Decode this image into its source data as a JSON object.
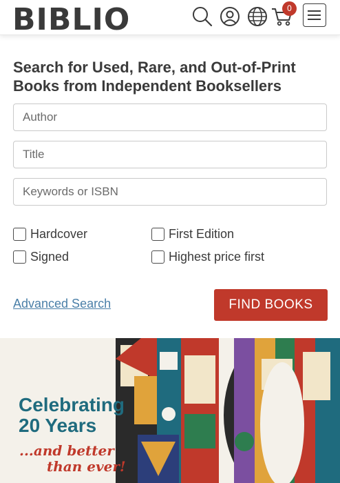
{
  "header": {
    "logo": "BIBLIO",
    "cart_count": "0",
    "icons": [
      "search-icon",
      "account-icon",
      "globe-icon",
      "cart-icon",
      "menu-icon"
    ]
  },
  "search": {
    "heading": "Search for Used, Rare, and Out-of-Print Books from Independent Booksellers",
    "author_placeholder": "Author",
    "title_placeholder": "Title",
    "keywords_placeholder": "Keywords or ISBN",
    "options": {
      "hardcover": "Hardcover",
      "first_edition": "First Edition",
      "signed": "Signed",
      "highest_price": "Highest price first"
    },
    "advanced_link": "Advanced Search",
    "submit_label": "FIND BOOKS"
  },
  "banner": {
    "title_line1": "Celebrating",
    "title_line2": "20 Years",
    "sub_line1": "...and better",
    "sub_line2": "than ever!"
  },
  "colors": {
    "accent": "#c0392b",
    "link": "#4a7fa8",
    "banner_title": "#1f6b7e"
  }
}
